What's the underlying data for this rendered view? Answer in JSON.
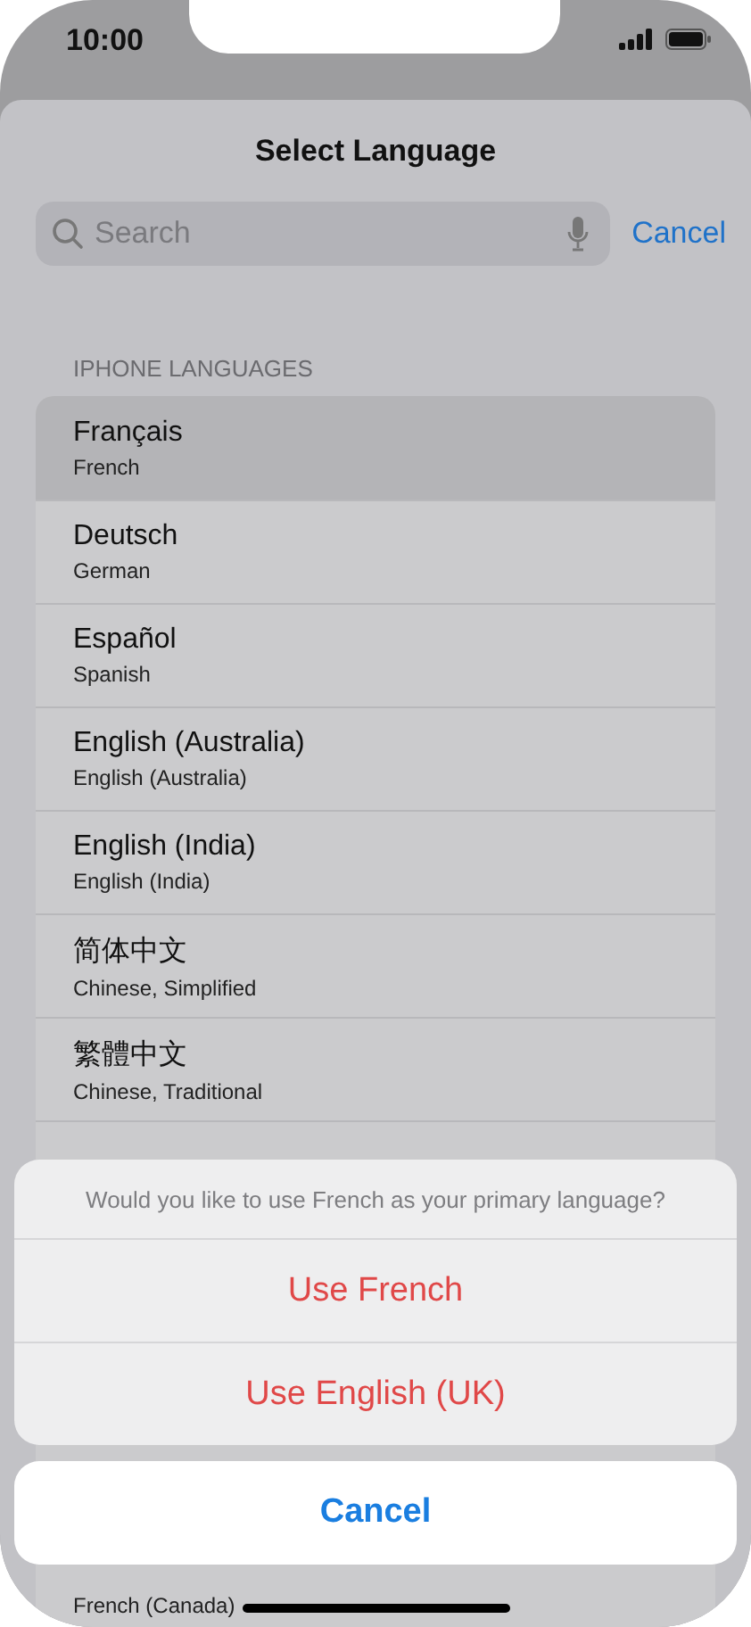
{
  "status_bar": {
    "time": "10:00"
  },
  "sheet": {
    "title": "Select Language",
    "search": {
      "placeholder": "Search"
    },
    "cancel": "Cancel"
  },
  "section": {
    "header": "IPHONE LANGUAGES",
    "rows": [
      {
        "name": "Français",
        "subtitle": "French",
        "selected": true
      },
      {
        "name": "Deutsch",
        "subtitle": "German",
        "selected": false
      },
      {
        "name": "Español",
        "subtitle": "Spanish",
        "selected": false
      },
      {
        "name": "English (Australia)",
        "subtitle": "English (Australia)",
        "selected": false
      },
      {
        "name": "English (India)",
        "subtitle": "English (India)",
        "selected": false
      },
      {
        "name": "简体中文",
        "subtitle": "Chinese, Simplified",
        "selected": false
      },
      {
        "name": "繁體中文",
        "subtitle": "Chinese, Traditional",
        "selected": false
      }
    ],
    "partial_row": {
      "subtitle": "French (Canada)"
    }
  },
  "action_sheet": {
    "message": "Would you like to use French as your primary language?",
    "actions": [
      "Use French",
      "Use English (UK)"
    ],
    "cancel": "Cancel"
  }
}
